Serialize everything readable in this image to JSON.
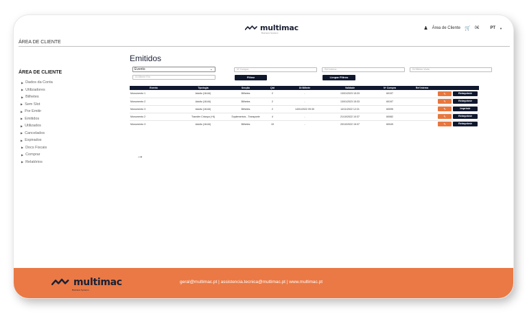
{
  "header": {
    "brand": "multimac",
    "brand_tagline": "Business Systems",
    "account_label": "Área de Cliente",
    "cart_label": "0€",
    "language": "PT"
  },
  "page_label": "ÁREA DE CLIENTE",
  "sidebar": {
    "title": "ÁREA DE CLIENTE",
    "items": [
      {
        "label": "Dados da Conta",
        "level": "top"
      },
      {
        "label": "Utilizadores",
        "level": "top"
      },
      {
        "label": "Bilhetes",
        "level": "top"
      },
      {
        "label": "Sem Slot",
        "level": "sub"
      },
      {
        "label": "Por Emitir",
        "level": "sub"
      },
      {
        "label": "Emitidos",
        "level": "sub"
      },
      {
        "label": "Utilizados",
        "level": "sub"
      },
      {
        "label": "Cancelados",
        "level": "sub"
      },
      {
        "label": "Expirados",
        "level": "sub"
      },
      {
        "label": "Docs Fiscais",
        "level": "top"
      },
      {
        "label": "Comprar",
        "level": "top"
      },
      {
        "label": "Relatórios",
        "level": "top"
      }
    ]
  },
  "main": {
    "title": "Emitidos",
    "filters": {
      "select_value": "Evento",
      "compra_placeholder": "Nº Compra",
      "ref_placeholder": "Ref Interna",
      "dt_visita_placeholder": "Dt Bilhete Visita",
      "dt_fim_placeholder": "Dt Bilhete Fim",
      "filter_button": "Filtrar",
      "clear_button": "Limpar Filtros"
    },
    "table": {
      "columns": [
        "Evento",
        "Tipologia",
        "Secção",
        "Qtd",
        "Dt Bilhete",
        "Validade",
        "Nº Compra",
        "Ref Interna",
        ""
      ],
      "rows": [
        {
          "evento": "Monumento 1",
          "tipologia": "Adulto (18-64)",
          "seccao": "Bilhetes",
          "qtd": "2",
          "dt": "-",
          "validade": "13/01/2023 15:33",
          "compra": "60197",
          "ref": "",
          "action": "Reimprimir"
        },
        {
          "evento": "Monumento 2",
          "tipologia": "Adulto (18-64)",
          "seccao": "Bilhetes",
          "qtd": "2",
          "dt": "-",
          "validade": "13/01/2023 15:33",
          "compra": "60197",
          "ref": "",
          "action": "Reimprimir"
        },
        {
          "evento": "Monumento 3",
          "tipologia": "Adulto (18-64)",
          "seccao": "Bilhetes",
          "qtd": "2",
          "dt": "14/01/2022 09:30",
          "validade": "14/11/2022 12:21",
          "compra": "60095",
          "ref": "",
          "action": "Imprimir"
        },
        {
          "evento": "Monumento 2",
          "tipologia": "Transfer Criança (+6)",
          "seccao": "Suplementos - Transporte",
          "qtd": "4",
          "dt": "-",
          "validade": "21/10/2022 10:37",
          "compra": "60082",
          "ref": "",
          "action": "Reimprimir"
        },
        {
          "evento": "Monumento 3",
          "tipologia": "Adulto (18-64)",
          "seccao": "Bilhetes",
          "qtd": "15",
          "dt": "-",
          "validade": "20/10/2022 15:37",
          "compra": "60049",
          "ref": "",
          "action": "Reimprimir"
        }
      ]
    },
    "next_arrow": "→"
  },
  "footer": {
    "brand": "multimac",
    "brand_tagline": "Business Systems",
    "links": "geral@multimac.pt | assistencia.tecnica@multimac.pt | www.multimac.pt"
  },
  "colors": {
    "navy": "#10182e",
    "orange": "#ea7945"
  },
  "icons": {
    "account": "user-icon",
    "cart": "cart-icon",
    "language_chevron": "chevron-down-icon",
    "edit": "pencil-icon"
  }
}
